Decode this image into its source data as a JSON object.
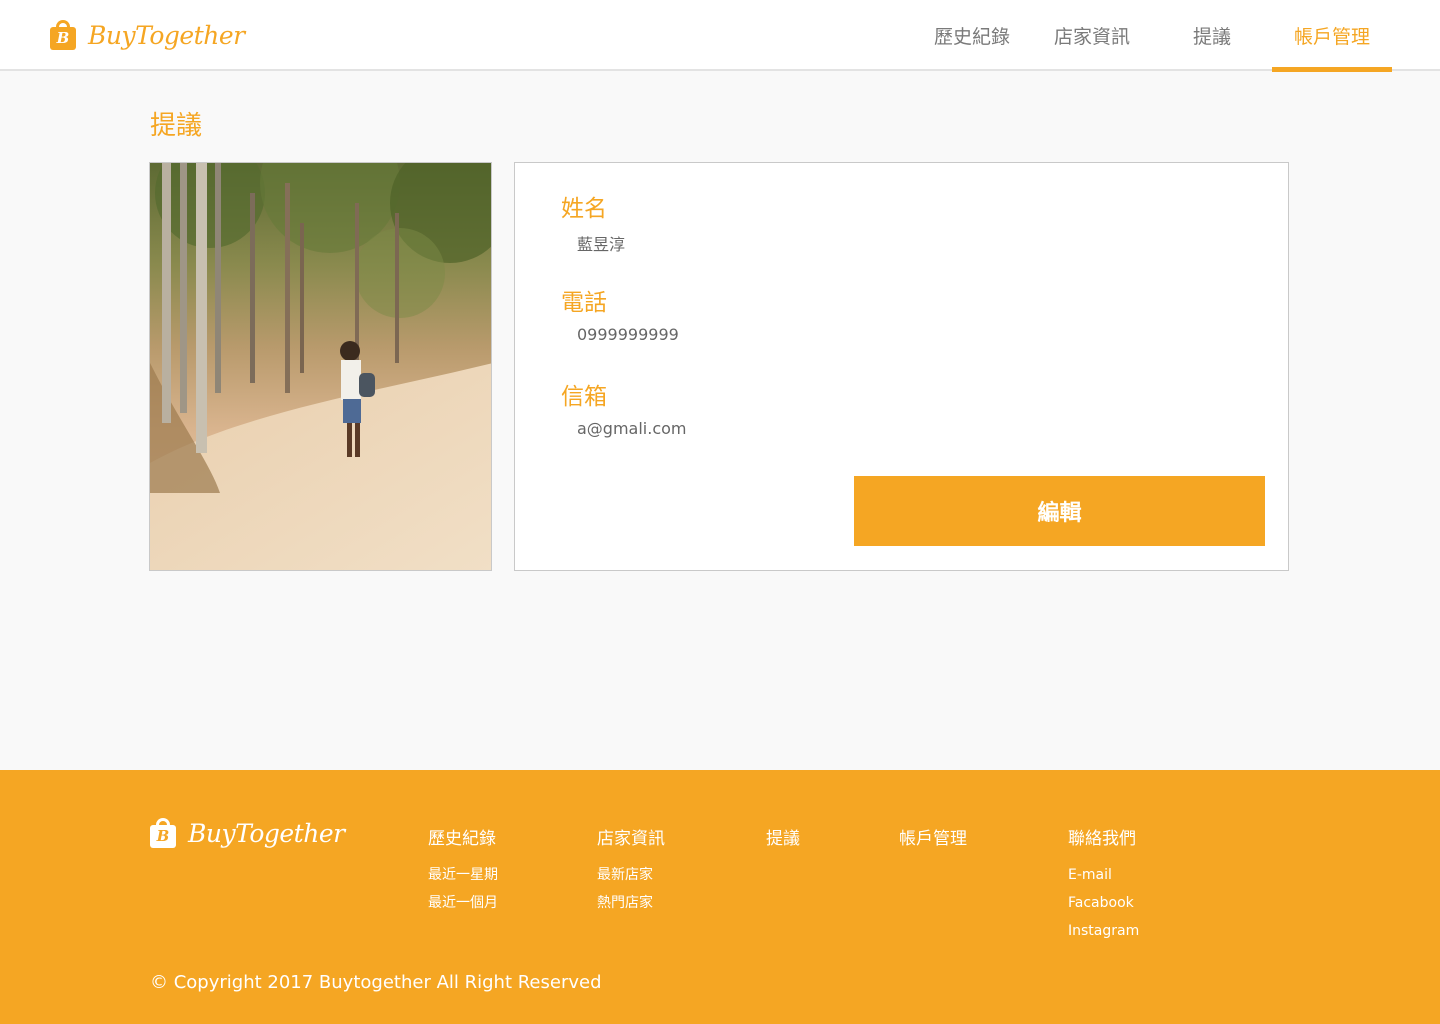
{
  "brand": {
    "name": "BuyTogether",
    "logo_letter": "B"
  },
  "nav": {
    "items": [
      {
        "label": "歷史紀錄"
      },
      {
        "label": "店家資訊"
      },
      {
        "label": "提議"
      },
      {
        "label": "帳戶管理"
      }
    ],
    "active": "帳戶管理"
  },
  "page": {
    "title": "提議"
  },
  "profile": {
    "name_label": "姓名",
    "name_value": "藍昱淳",
    "phone_label": "電話",
    "phone_value": "0999999999",
    "email_label": "信箱",
    "email_value": "a@gmali.com",
    "edit_label": "編輯"
  },
  "footer": {
    "columns": [
      {
        "title": "歷史紀錄",
        "links": [
          "最近一星期",
          "最近一個月"
        ]
      },
      {
        "title": "店家資訊",
        "links": [
          "最新店家",
          "熱門店家"
        ]
      },
      {
        "title": "提議",
        "links": []
      },
      {
        "title": "帳戶管理",
        "links": []
      },
      {
        "title": "聯絡我們",
        "links": [
          "E-mail",
          "Facabook",
          "Instagram"
        ]
      }
    ],
    "copyright": "© Copyright 2017 Buytogether All Right Reserved"
  },
  "colors": {
    "accent": "#f5a623",
    "background": "#f9f9f9",
    "card": "#ffffff"
  },
  "icons": {
    "logo": "shopping-bag-icon"
  }
}
